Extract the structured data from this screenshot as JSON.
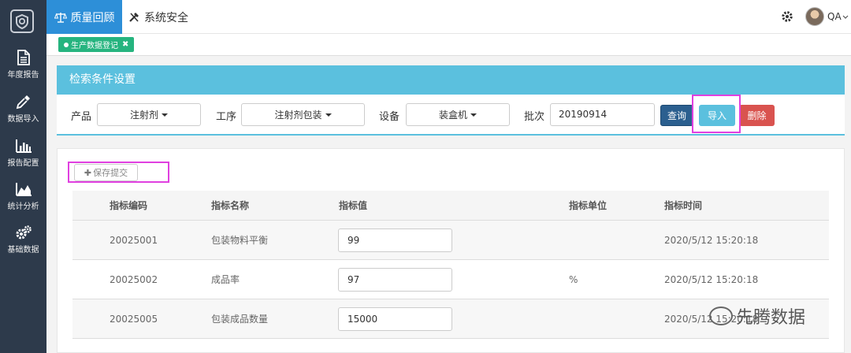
{
  "sidebar": {
    "items": [
      {
        "label": "年度报告",
        "icon": "document-icon"
      },
      {
        "label": "数据导入",
        "icon": "pipette-icon"
      },
      {
        "label": "报告配置",
        "icon": "bar-chart-icon"
      },
      {
        "label": "统计分析",
        "icon": "area-chart-icon"
      },
      {
        "label": "基础数据",
        "icon": "gears-icon"
      }
    ]
  },
  "topbar": {
    "tabs": [
      {
        "label": "质量回顾",
        "icon": "scale-icon"
      },
      {
        "label": "系统安全",
        "icon": "tools-icon"
      }
    ],
    "user": "QA"
  },
  "subtab": {
    "label": "生产数据登记"
  },
  "search_panel": {
    "title": "检索条件设置",
    "product_label": "产品",
    "product_value": "注射剂",
    "process_label": "工序",
    "process_value": "注射剂包装",
    "equipment_label": "设备",
    "equipment_value": "装盒机",
    "batch_label": "批次",
    "batch_value": "20190914",
    "query_label": "查询",
    "import_label": "导入",
    "delete_label": "删除"
  },
  "save_label": "保存提交",
  "table": {
    "headers": [
      "指标编码",
      "指标名称",
      "指标值",
      "指标单位",
      "指标时间"
    ],
    "rows": [
      {
        "code": "20025001",
        "name": "包装物料平衡",
        "value": "99",
        "unit": "",
        "time": "2020/5/12 15:20:18"
      },
      {
        "code": "20025002",
        "name": "成品率",
        "value": "97",
        "unit": "%",
        "time": "2020/5/12 15:20:18"
      },
      {
        "code": "20025005",
        "name": "包装成品数量",
        "value": "15000",
        "unit": "",
        "time": "2020/5/12 15:20:18"
      }
    ]
  },
  "watermark": "先腾数据",
  "colors": {
    "sidebar": "#2d3a4b",
    "primary": "#2d8fd8",
    "info": "#5bc0de",
    "success": "#26b47f",
    "query": "#2b5f8f",
    "danger": "#d9534f",
    "highlight": "#e040e0"
  }
}
